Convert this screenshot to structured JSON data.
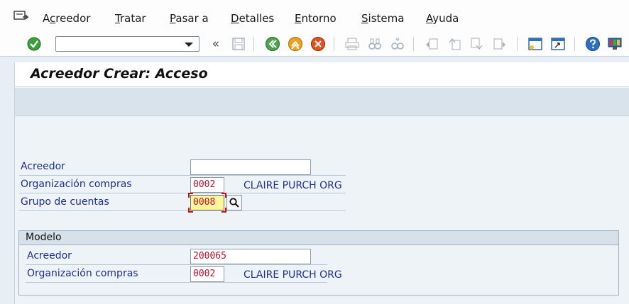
{
  "menu": {
    "items": [
      {
        "key": "acreedor",
        "pre": "A",
        "u": "c",
        "post": "reedor"
      },
      {
        "key": "tratar",
        "pre": "",
        "u": "T",
        "post": "ratar"
      },
      {
        "key": "pasar",
        "pre": "",
        "u": "P",
        "post": "asar a"
      },
      {
        "key": "detalles",
        "pre": "",
        "u": "D",
        "post": "etalles"
      },
      {
        "key": "entorno",
        "pre": "",
        "u": "E",
        "post": "ntorno"
      },
      {
        "key": "sistema",
        "pre": "",
        "u": "S",
        "post": "istema"
      },
      {
        "key": "ayuda",
        "pre": "",
        "u": "A",
        "post": "yuda"
      }
    ]
  },
  "toolbar": {
    "command_value": "",
    "expand_glyph": "«"
  },
  "page": {
    "title": "Acreedor Crear: Acceso"
  },
  "form": {
    "acreedor_label": "Acreedor",
    "acreedor_value": "",
    "org_label": "Organización compras",
    "org_value": "0002",
    "org_desc": "CLAIRE PURCH ORG",
    "grupo_label": "Grupo de cuentas",
    "grupo_value": "0008"
  },
  "modelo": {
    "header": "Modelo",
    "acreedor_label": "Acreedor",
    "acreedor_value": "200065",
    "org_label": "Organización compras",
    "org_value": "0002",
    "org_desc": "CLAIRE PURCH ORG"
  },
  "colors": {
    "label_blue": "#1f2f8f",
    "value_red": "#c0102a",
    "focus_yellow": "#fff59a"
  }
}
